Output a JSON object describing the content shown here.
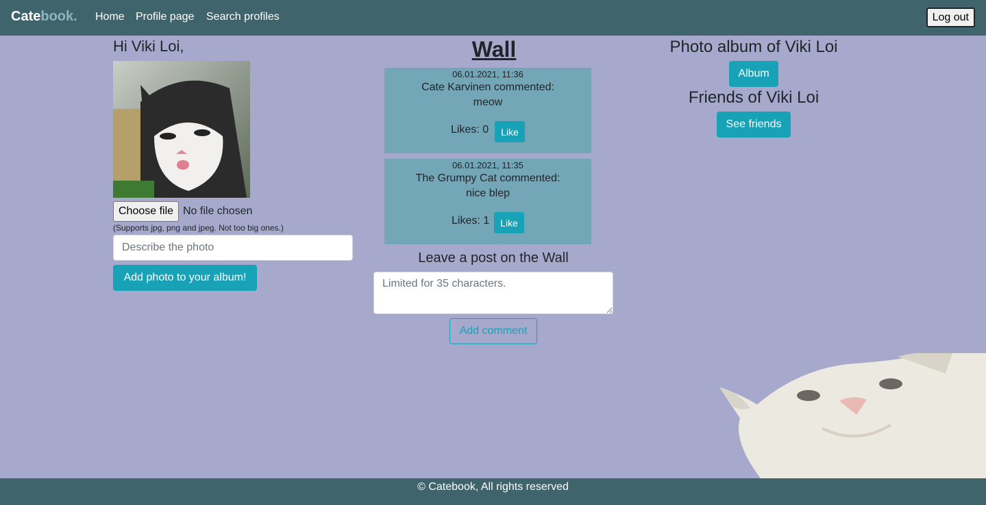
{
  "navbar": {
    "brand_main": "Cate",
    "brand_accent": "book.",
    "links": [
      "Home",
      "Profile page",
      "Search profiles"
    ],
    "logout_label": "Log out"
  },
  "left": {
    "greeting": "Hi Viki Loi,",
    "choose_file_label": "Choose file",
    "file_status": "No file chosen",
    "supports_note": "(Supports jpg, png and jpeg. Not too big ones.)",
    "describe_placeholder": "Describe the photo",
    "add_photo_label": "Add photo to your album!"
  },
  "wall": {
    "title": "Wall",
    "posts": [
      {
        "date": "06.01.2021, 11:36",
        "author": "Cate Karvinen commented:",
        "text": "meow",
        "likes": "Likes: 0",
        "like_label": "Like"
      },
      {
        "date": "06.01.2021, 11:35",
        "author": "The Grumpy Cat commented:",
        "text": "nice blep",
        "likes": "Likes: 1",
        "like_label": "Like"
      }
    ],
    "leave_post_title": "Leave a post on the Wall",
    "textarea_placeholder": "Limited for 35 characters.",
    "add_comment_label": "Add comment"
  },
  "right": {
    "album_title": "Photo album of Viki Loi",
    "album_label": "Album",
    "friends_title": "Friends of Viki Loi",
    "friends_label": "See friends"
  },
  "footer": {
    "text": "© Catebook, All rights reserved"
  },
  "colors": {
    "navbar": "#3f646c",
    "background": "#a6a9cc",
    "accent": "#17a2b8",
    "post_bg": "#73a6b6"
  }
}
